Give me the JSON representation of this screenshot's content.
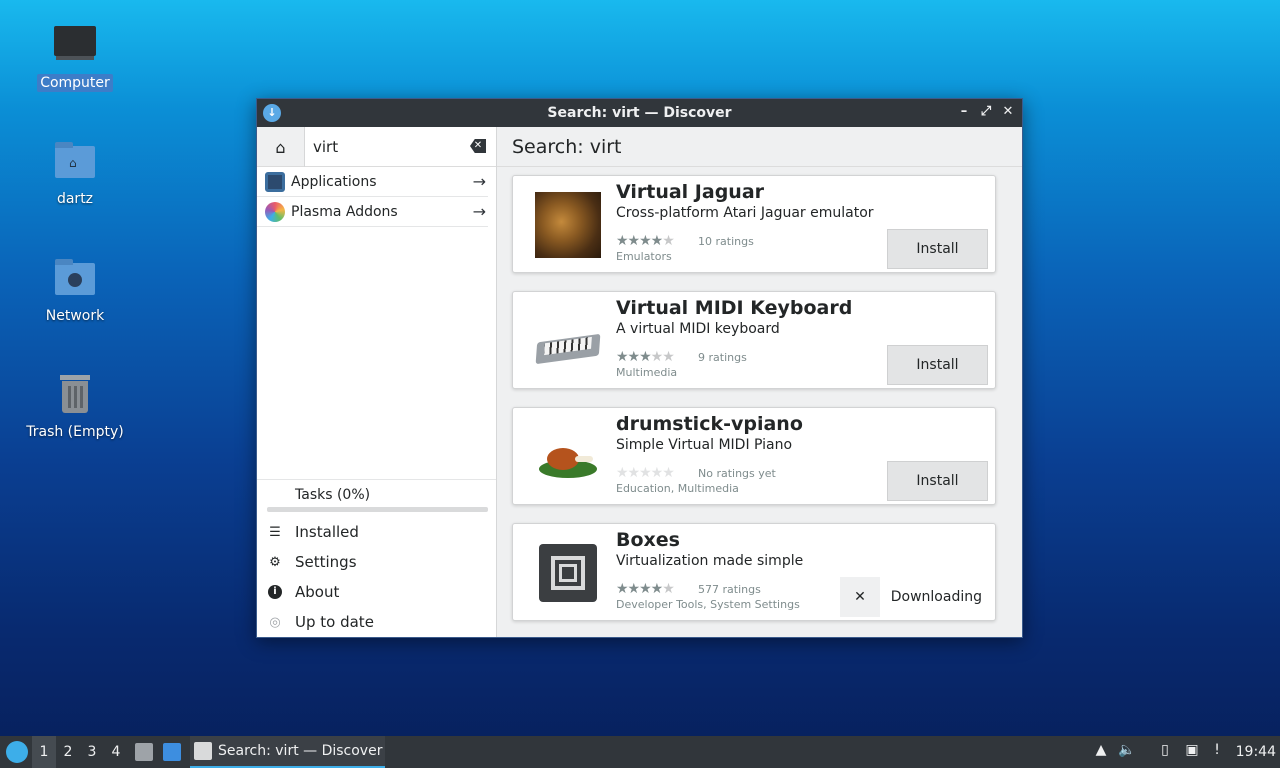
{
  "desktop": {
    "icons": [
      {
        "label": "Computer",
        "icon": "monitor-icon"
      },
      {
        "label": "dartz",
        "icon": "home-folder-icon"
      },
      {
        "label": "Network",
        "icon": "network-folder-icon"
      },
      {
        "label": "Trash (Empty)",
        "icon": "trash-icon"
      }
    ]
  },
  "window": {
    "title": "Search: virt — Discover"
  },
  "sidebar": {
    "search_value": "virt",
    "categories": [
      {
        "label": "Applications"
      },
      {
        "label": "Plasma Addons"
      }
    ],
    "tasks_label": "Tasks (0%)",
    "tasks_progress": 0,
    "nav": [
      {
        "label": "Installed",
        "icon": "list-icon"
      },
      {
        "label": "Settings",
        "icon": "gear-icon"
      },
      {
        "label": "About",
        "icon": "info-icon"
      },
      {
        "label": "Up to date",
        "icon": "update-icon"
      }
    ]
  },
  "main": {
    "header": "Search: virt",
    "results": [
      {
        "name": "Virtual Jaguar",
        "desc": "Cross-platform Atari Jaguar emulator",
        "stars": 4,
        "rating": "10 ratings",
        "category": "Emulators",
        "action": "Install"
      },
      {
        "name": "Virtual MIDI Keyboard",
        "desc": "A virtual MIDI keyboard",
        "stars": 3,
        "rating": "9 ratings",
        "category": "Multimedia",
        "action": "Install"
      },
      {
        "name": "drumstick-vpiano",
        "desc": "Simple Virtual MIDI Piano",
        "stars": 0,
        "rating": "No ratings yet",
        "category": "Education, Multimedia",
        "action": "Install"
      },
      {
        "name": "Boxes",
        "desc": "Virtualization made simple",
        "stars": 4,
        "rating": "577 ratings",
        "category": "Developer Tools, System Settings",
        "action": "Downloading"
      }
    ]
  },
  "taskbar": {
    "workspaces": [
      "1",
      "2",
      "3",
      "4"
    ],
    "task_label": "Search: virt — Discover",
    "clock": "19:44"
  },
  "colors": {
    "accent": "#3daee9",
    "titlebar": "#31363b",
    "star_filled": "#7f8c8d",
    "star_empty": "#d6d7d8"
  }
}
